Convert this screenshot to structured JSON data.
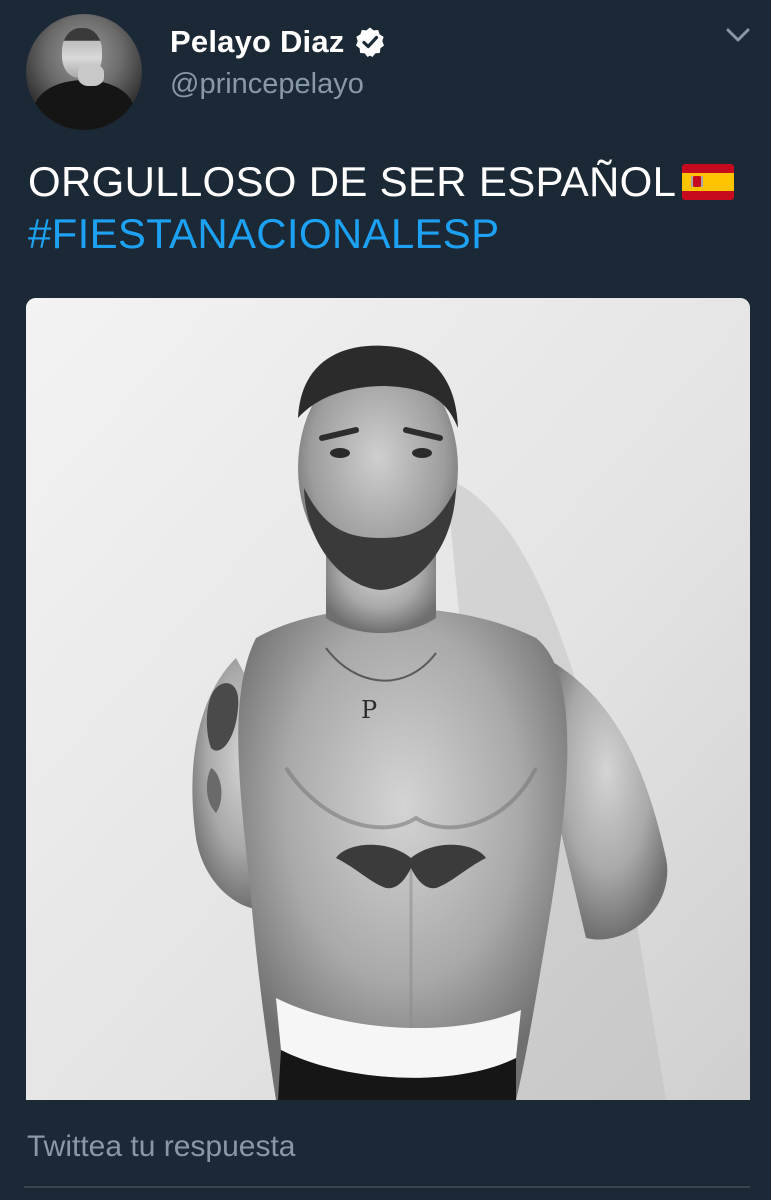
{
  "tweet": {
    "author": {
      "display_name": "Pelayo Diaz",
      "handle": "@princepelayo",
      "verified": true,
      "avatar_icon": "profile-avatar"
    },
    "text": "ORGULLOSO DE SER ESPAÑOL",
    "emoji": "spain-flag-icon",
    "hashtag": "#FIESTANACIONALESP",
    "media": {
      "type": "photo",
      "tattoo_letter": "P"
    }
  },
  "reply": {
    "placeholder": "Twittea tu respuesta"
  },
  "colors": {
    "background": "#1b2836",
    "hashtag": "#1da1f2",
    "secondary_text": "#8899a6"
  }
}
